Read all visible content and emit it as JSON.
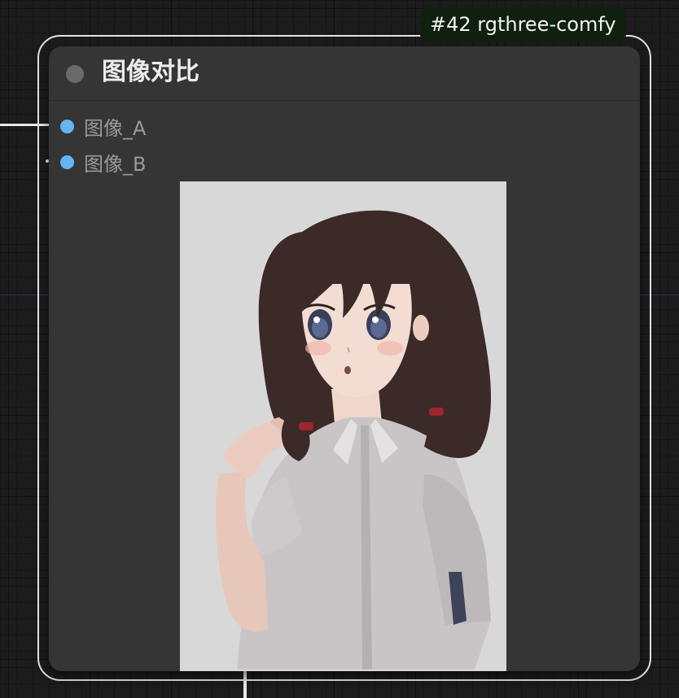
{
  "canvas": {
    "grid_color": "#151515",
    "background_color": "#1c1c1c",
    "guide_color": "#2a3156"
  },
  "badge": {
    "text": "#42 rgthree-comfy",
    "background": "#10200f"
  },
  "node": {
    "title": "图像对比",
    "background": "#353535",
    "inputs": [
      {
        "label": "图像_A",
        "dot_color": "#64b5f6",
        "connected": true
      },
      {
        "label": "图像_B",
        "dot_color": "#64b5f6",
        "connected": true
      }
    ],
    "preview": {
      "background": "#d9d8d8",
      "subject": "anime-girl-illustration"
    }
  }
}
